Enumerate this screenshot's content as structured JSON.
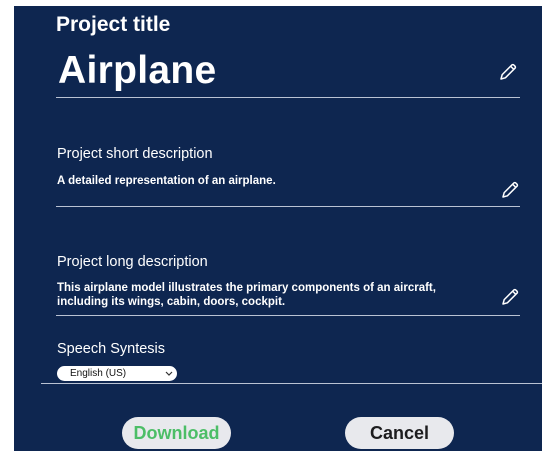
{
  "project_title": {
    "label": "Project title",
    "value": "Airplane"
  },
  "short_description": {
    "label": "Project short description",
    "value": "A detailed representation of an airplane."
  },
  "long_description": {
    "label": "Project long description",
    "line1": "This airplane model illustrates the primary components of an aircraft,",
    "line2": "including its wings, cabin, doors, cockpit."
  },
  "speech_synthesis": {
    "label": "Speech Syntesis",
    "selected_language": "English (US)"
  },
  "actions": {
    "download_label": "Download",
    "cancel_label": "Cancel"
  },
  "colors": {
    "panel_background": "#0e2650",
    "download_text": "#4cbe67",
    "button_background": "#e8e9ed"
  },
  "icons": [
    "pencil-edit-icon",
    "chevron-down-icon"
  ]
}
